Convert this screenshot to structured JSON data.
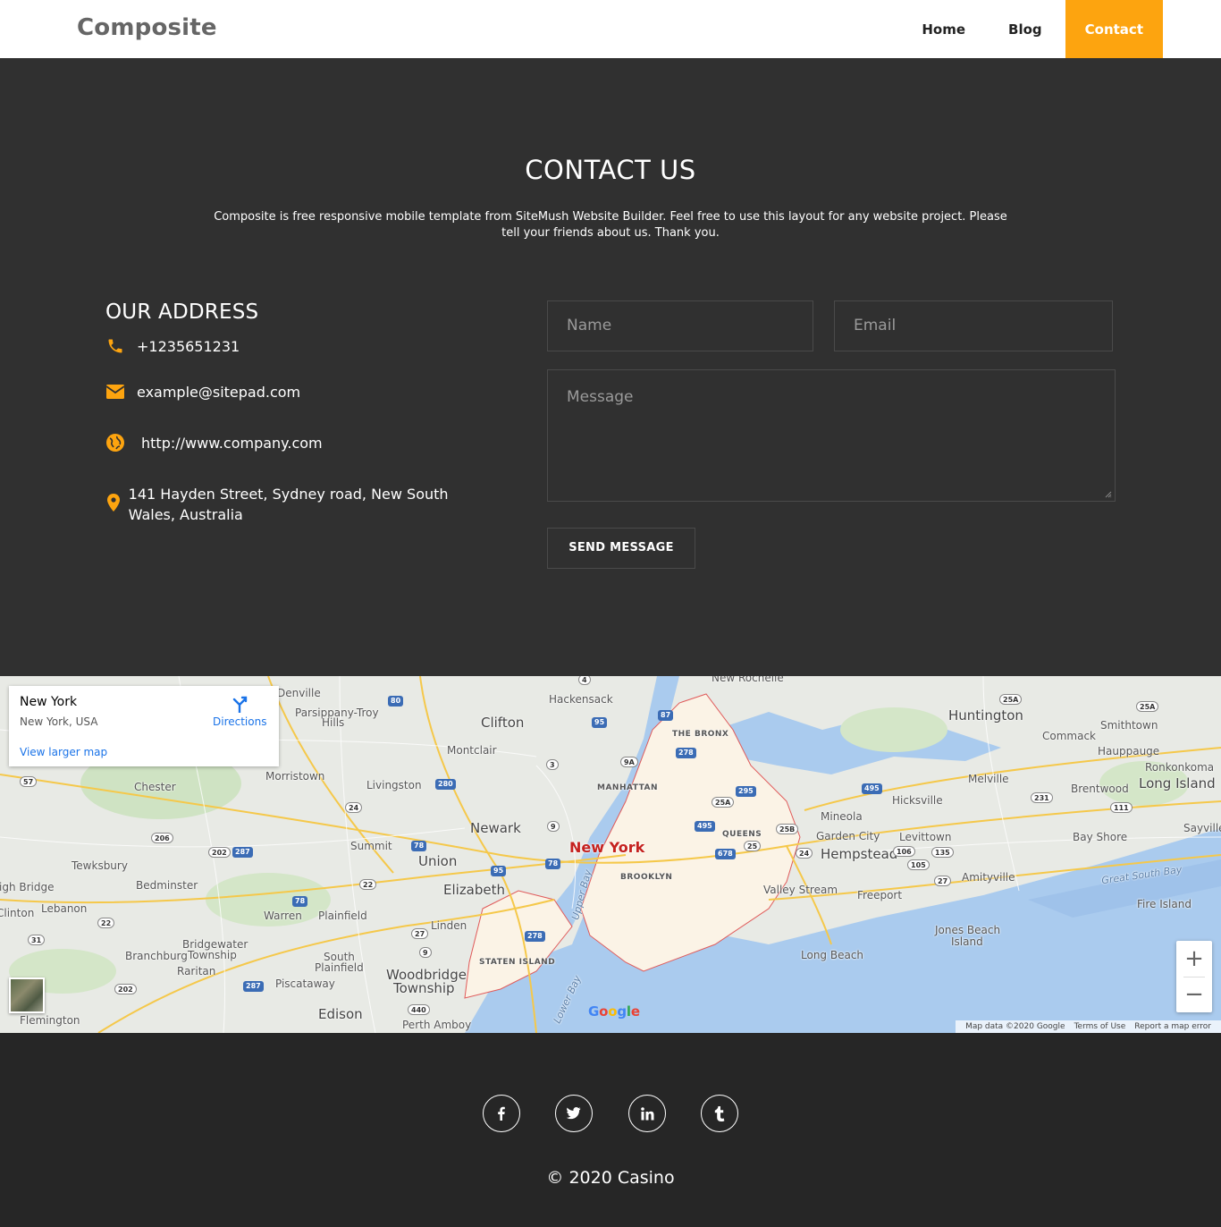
{
  "header": {
    "brand": "Composite",
    "nav": [
      {
        "label": "Home"
      },
      {
        "label": "Blog"
      },
      {
        "label": "Contact",
        "active": true
      }
    ],
    "accent_color": "#fda40f"
  },
  "contact": {
    "title": "CONTACT US",
    "lead": "Composite is free responsive mobile template from SiteMush Website Builder. Feel free to use this layout for any website project. Please tell your friends about us. Thank you.",
    "address_title": "OUR ADDRESS",
    "items": [
      {
        "icon": "phone-icon",
        "text": "+1235651231"
      },
      {
        "icon": "envelope-icon",
        "text": "example@sitepad.com"
      },
      {
        "icon": "globe-icon",
        "text": "http://www.company.com"
      },
      {
        "icon": "map-marker-icon",
        "text": "141 Hayden Street, Sydney road, New South Wales, Australia"
      }
    ],
    "form": {
      "name_placeholder": "Name",
      "email_placeholder": "Email",
      "message_placeholder": "Message",
      "send_label": "SEND MESSAGE"
    }
  },
  "map": {
    "info": {
      "title": "New York",
      "subtitle": "New York, USA",
      "directions_label": "Directions",
      "larger_map_label": "View larger map"
    },
    "labels": {
      "new_york": "New York",
      "hackensack": "Hackensack",
      "clifton": "Clifton",
      "montclair": "Montclair",
      "parsippany": "Parsippany-Troy",
      "hills": "Hills",
      "denville": "Denville",
      "morristown": "Morristown",
      "livingston": "Livingston",
      "chester": "Chester",
      "newark": "Newark",
      "summit": "Summit",
      "union": "Union",
      "elizabeth": "Elizabeth",
      "tewksbury": "Tewksbury",
      "bedminster": "Bedminster",
      "high_bridge": "High Bridge",
      "clinton": "Clinton",
      "lebanon": "Lebanon",
      "warren": "Warren",
      "plainfield": "Plainfield",
      "linden": "Linden",
      "bridgewater": "Bridgewater",
      "township": "Township",
      "branchburg": "Branchburg",
      "raritan": "Raritan",
      "south": "South",
      "plainfield2": "Plainfield",
      "piscataway": "Piscataway",
      "woodbridge": "Woodbridge",
      "township2": "Township",
      "edison": "Edison",
      "perth_amboy": "Perth Amboy",
      "flemington": "Flemington",
      "bronx": "THE BRONX",
      "manhattan": "MANHATTAN",
      "queens": "QUEENS",
      "brooklyn": "BROOKLYN",
      "staten_island": "STATEN ISLAND",
      "new_rochelle": "New Rochelle",
      "huntington": "Huntington",
      "smithtown": "Smithtown",
      "commack": "Commack",
      "hauppauge": "Hauppauge",
      "ronkonkoma": "Ronkonkoma",
      "melville": "Melville",
      "long_island": "Long Island",
      "hicksville": "Hicksville",
      "brentwood": "Brentwood",
      "mineola": "Mineola",
      "garden_city": "Garden City",
      "levittown": "Levittown",
      "hempstead": "Hempstead",
      "bay_shore": "Bay Shore",
      "sayville": "Sayville",
      "valley_stream": "Valley Stream",
      "freeport": "Freeport",
      "amityville": "Amityville",
      "great_south_bay": "Great South Bay",
      "fire_island": "Fire Island",
      "jones_beach": "Jones Beach",
      "island": "Island",
      "long_beach": "Long Beach",
      "upper_bay": "Upper Bay",
      "lower_bay": "Lower Bay"
    },
    "shields": [
      "4",
      "80",
      "95",
      "87",
      "9A",
      "278",
      "295",
      "25A",
      "495",
      "678",
      "25B",
      "24",
      "106",
      "105",
      "135",
      "27",
      "25",
      "231",
      "111",
      "3",
      "280",
      "24",
      "206",
      "202",
      "287",
      "78",
      "22",
      "95",
      "9",
      "78",
      "78",
      "22",
      "27",
      "9",
      "278",
      "31",
      "57",
      "202",
      "287",
      "440",
      "25A",
      "25A",
      "495"
    ],
    "attribution": [
      "Map data ©2020 Google",
      "Terms of Use",
      "Report a map error"
    ],
    "google_logo": "Google",
    "zoom_in": "+",
    "zoom_out": "−"
  },
  "footer": {
    "social": [
      "facebook-icon",
      "twitter-icon",
      "linkedin-icon",
      "tumblr-icon"
    ],
    "copyright": "© 2020 Casino"
  }
}
